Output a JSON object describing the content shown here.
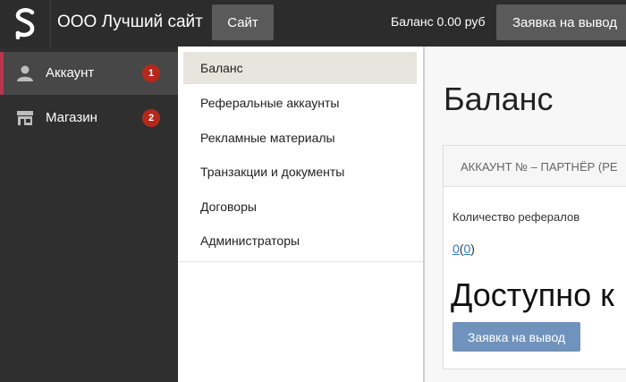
{
  "header": {
    "brand": "ООО Лучший сайт",
    "site_button": "Сайт",
    "balance_text": "Баланс 0.00 руб",
    "withdraw_button": "Заявка на вывод"
  },
  "sidebar": {
    "items": [
      {
        "label": "Аккаунт",
        "icon": "user-icon",
        "badge": "1",
        "active": true
      },
      {
        "label": "Магазин",
        "icon": "store-icon",
        "badge": "2",
        "active": false
      }
    ]
  },
  "submenu": {
    "items": [
      {
        "label": "Баланс",
        "active": true
      },
      {
        "label": "Реферальные аккаунты"
      },
      {
        "label": "Рекламные материалы"
      },
      {
        "label": "Транзакции и документы"
      },
      {
        "label": "Договоры"
      },
      {
        "label": "Администраторы"
      }
    ]
  },
  "main": {
    "title": "Баланс",
    "card_header": "АККАУНТ № – ПАРТНЁР (РЕ",
    "referrals_label": "Количество рефералов",
    "referrals_value_a": "0",
    "referrals_value_b": "0",
    "available_text": "Доступно к",
    "withdraw_button": "Заявка на вывод"
  },
  "colors": {
    "topbar": "#2c2c2c",
    "sidebar": "#2f2f2f",
    "active_accent": "#b8364d",
    "badge": "#b3291c",
    "primary_button": "#6f93bd"
  }
}
